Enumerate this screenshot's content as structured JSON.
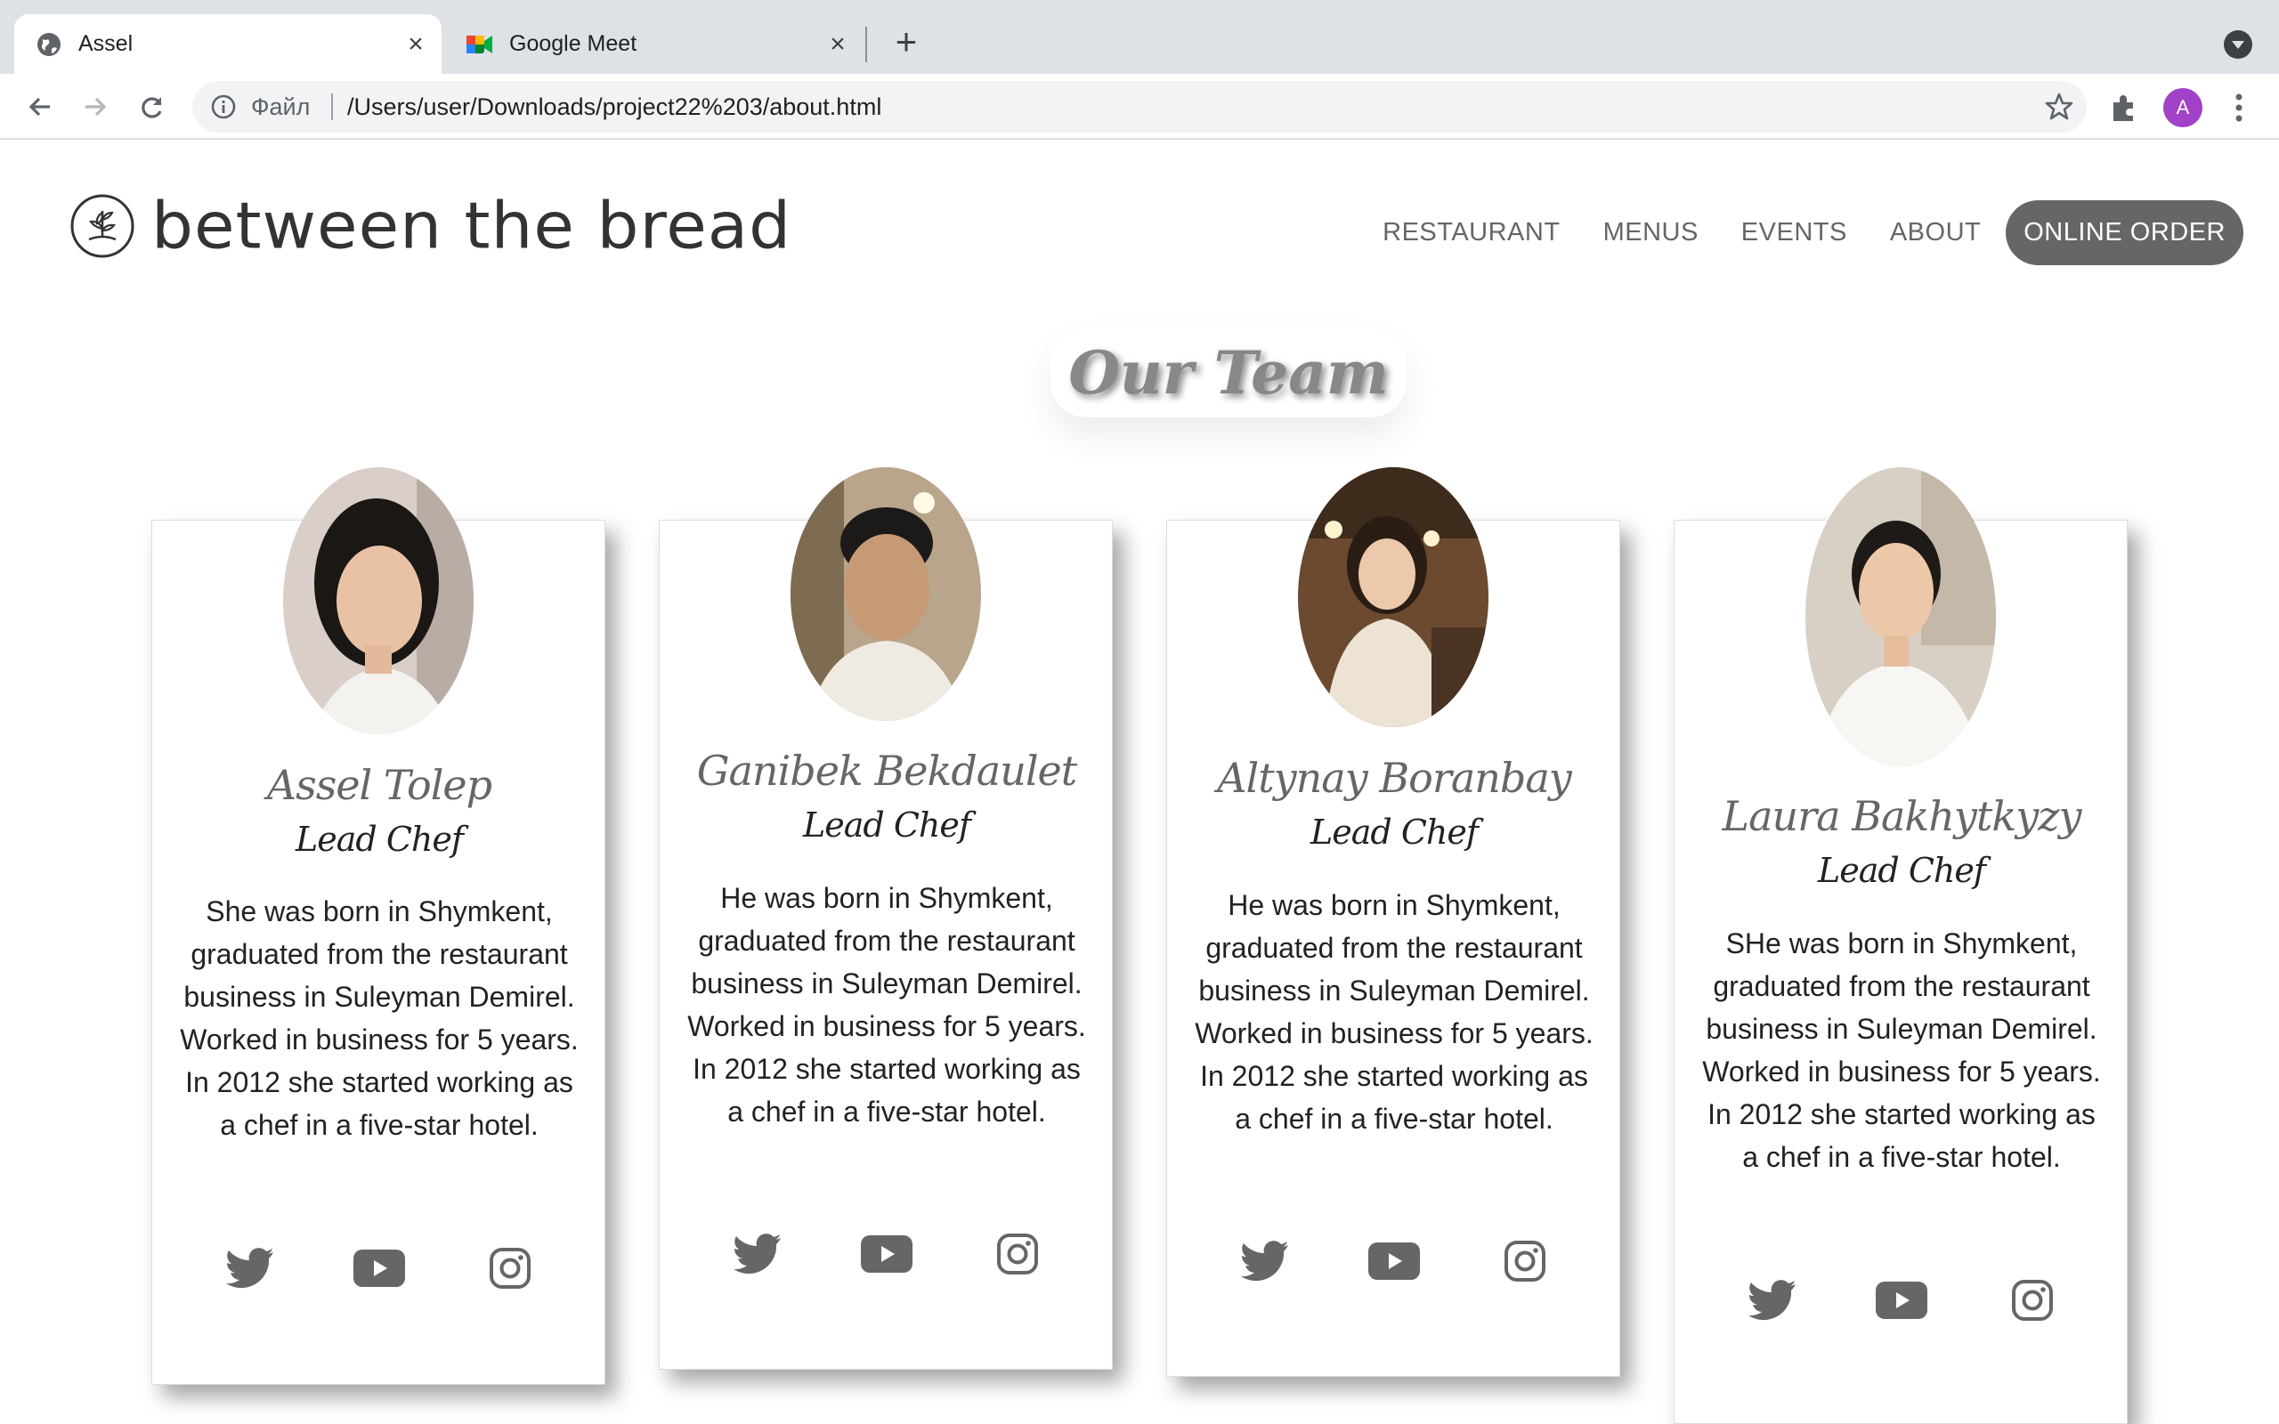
{
  "browser": {
    "tabs": [
      {
        "title": "Assel",
        "active": true
      },
      {
        "title": "Google Meet",
        "active": false
      }
    ],
    "address": {
      "scheme_label": "Файл",
      "url": "/Users/user/Downloads/project22%203/about.html"
    },
    "profile_initial": "A"
  },
  "site": {
    "logo": "between the bread",
    "nav": [
      "RESTAURANT",
      "MENUS",
      "EVENTS",
      "ABOUT"
    ],
    "cta": "ONLINE ORDER"
  },
  "main": {
    "title": "Our Team",
    "members": [
      {
        "name": "Assel Tolep",
        "role": "Lead Chef",
        "bio": "She was born in Shymkent, graduated from the restaurant business in Suleyman Demirel. Worked in business for 5 years. In 2012 she started working as a chef in a five-star hotel."
      },
      {
        "name": "Ganibek Bekdaulet",
        "role": "Lead Chef",
        "bio": "He was born in Shymkent, graduated from the restaurant business in Suleyman Demirel. Worked in business for 5 years. In 2012 she started working as a chef in a five-star hotel."
      },
      {
        "name": "Altynay Boranbay",
        "role": "Lead Chef",
        "bio": "He was born in Shymkent, graduated from the restaurant business in Suleyman Demirel. Worked in business for 5 years. In 2012 she started working as a chef in a five-star hotel."
      },
      {
        "name": "Laura Bakhytkyzy",
        "role": "Lead Chef",
        "bio": "SHe was born in Shymkent, graduated from the restaurant business in Suleyman Demirel. Worked in business for 5 years. In 2012 she started working as a chef in a five-star hotel."
      }
    ],
    "social_icons": [
      "twitter-icon",
      "youtube-icon",
      "instagram-icon"
    ]
  },
  "colors": {
    "nav_button": "#666666",
    "profile_avatar": "#a142c8",
    "tab_strip": "#dee1e6"
  }
}
